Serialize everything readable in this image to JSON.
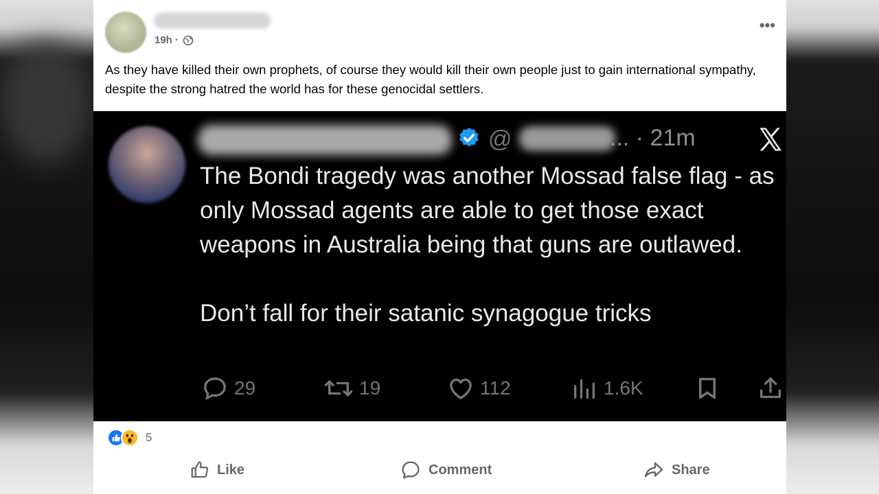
{
  "post": {
    "time": "19h",
    "time_separator": "·",
    "caption": "As they have killed their own prophets, of course they would kill their own people just to gain international sympathy, despite the strong hatred the world has for these genocidal settlers.",
    "more_label": "•••"
  },
  "tweet": {
    "at_symbol": "@",
    "time": "... · 21m",
    "body_line1": "The Bondi tragedy was another Mossad false flag - as only Mossad agents are able to get those exact weapons in Australia being that guns are outlawed.",
    "body_line2": "Don’t fall for their satanic synagogue tricks",
    "replies": "29",
    "retweets": "19",
    "likes": "112",
    "views": "1.6K",
    "x_logo": "X",
    "verified_color": "#1d9bf0"
  },
  "reactions": {
    "count": "5"
  },
  "actions": {
    "like": "Like",
    "comment": "Comment",
    "share": "Share"
  },
  "icons": [
    "globe-icon",
    "more-icon",
    "verified-icon",
    "x-logo-icon",
    "reply-icon",
    "retweet-icon",
    "heart-icon",
    "views-icon",
    "bookmark-icon",
    "upload-icon",
    "like-reaction-icon",
    "wow-reaction-icon",
    "thumbs-up-icon",
    "comment-icon",
    "share-icon"
  ]
}
